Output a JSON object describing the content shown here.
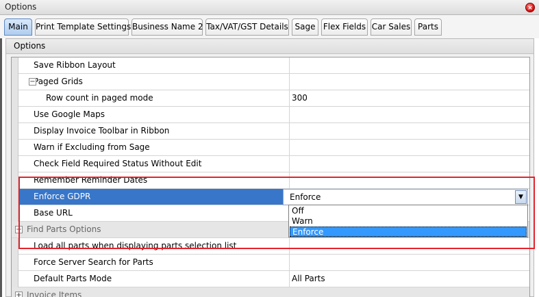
{
  "window": {
    "title": "Options",
    "close_symbol": "×"
  },
  "tabs": [
    {
      "label": "Main",
      "active": true
    },
    {
      "label": "Print Template Settings"
    },
    {
      "label": "Business Name 2"
    },
    {
      "label": "Tax/VAT/GST Details"
    },
    {
      "label": "Sage"
    },
    {
      "label": "Flex Fields"
    },
    {
      "label": "Car Sales"
    },
    {
      "label": "Parts"
    }
  ],
  "panel": {
    "title": "Options"
  },
  "grid": {
    "rows": [
      {
        "name": "Save Ribbon Layout",
        "checked": true,
        "check_mark": "✔"
      },
      {
        "name": "Paged Grids",
        "expander": "−",
        "checked": false,
        "check_mark": ""
      },
      {
        "name": "Row count in paged mode",
        "value": "300"
      },
      {
        "name": "Use Google Maps",
        "checked": true,
        "check_mark": "✔"
      },
      {
        "name": "Display Invoice Toolbar in Ribbon",
        "checked": false,
        "check_mark": ""
      },
      {
        "name": "Warn if Excluding from Sage",
        "checked": true,
        "check_mark": "✔"
      },
      {
        "name": "Check Field Required Status Without Edit",
        "checked": false,
        "check_mark": ""
      },
      {
        "name": "Remember Reminder Dates",
        "checked": false,
        "check_mark": ""
      },
      {
        "name": "Enforce GDPR",
        "selected": true
      },
      {
        "name": "Base URL"
      },
      {
        "name": "Find Parts Options",
        "expander": "+"
      },
      {
        "name": "Load all parts when displaying parts selection list",
        "checked": true,
        "check_mark": "✔"
      },
      {
        "name": "Force Server Search for Parts",
        "checked": false,
        "check_mark": ""
      },
      {
        "name": "Default Parts Mode",
        "value": "All Parts"
      },
      {
        "name": "Invoice Items",
        "expander": "+"
      }
    ]
  },
  "combo": {
    "value": "Enforce",
    "arrow": "▼",
    "options": [
      "Off",
      "Warn",
      "Enforce"
    ],
    "selected": "Enforce"
  },
  "colors": {
    "selection": "#3876c9",
    "highlight_outline": "#e4222a",
    "dropdown_selected": "#3399ff"
  }
}
